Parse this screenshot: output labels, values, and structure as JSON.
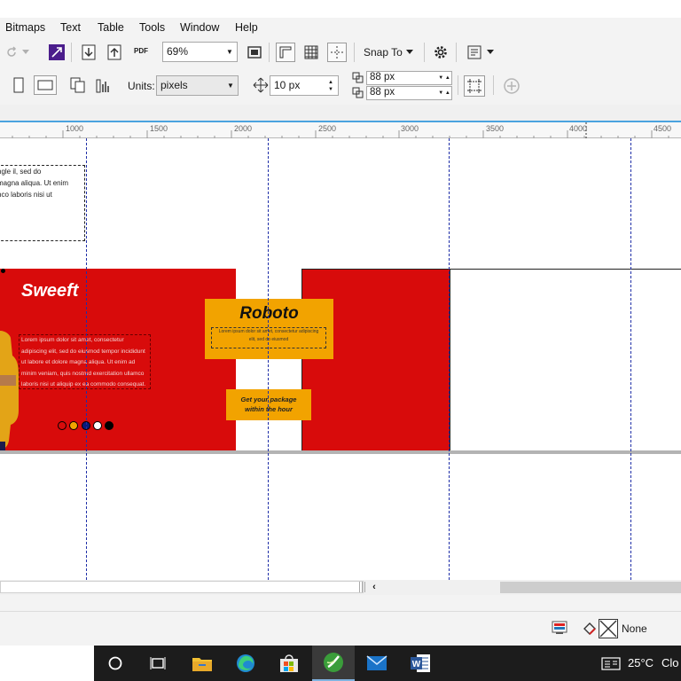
{
  "menu": {
    "items": [
      {
        "label": "Bitmaps"
      },
      {
        "label": "Text"
      },
      {
        "label": "Table"
      },
      {
        "label": "Tools"
      },
      {
        "label": "Window"
      },
      {
        "label": "Help"
      }
    ]
  },
  "toolbar": {
    "zoom_value": "69%",
    "snap_label": "Snap To",
    "pdf_label": "PDF"
  },
  "property_bar": {
    "units_label": "Units:",
    "units_value": "pixels",
    "nudge_value": "10 px",
    "dup_x_value": "88 px",
    "dup_y_value": "88 px"
  },
  "ruler": {
    "labels": [
      "1000",
      "1500",
      "2000",
      "2500",
      "3000",
      "3500",
      "4000",
      "4500"
    ]
  },
  "canvas": {
    "textbox_lines": [
      "ngle il, sed do",
      "magna aliqua. Ut enim",
      "nco laboris nisi ut"
    ],
    "banner": {
      "brand": "Sweeft",
      "body_lines": [
        "Lorem ipsum dolor sit amet, consectetur",
        "adipiscing elit, sed do eiusmod tempor incididunt",
        "ut labore et dolore magna aliqua. Ut enim ad",
        "minim veniam, quis nostrud exercitation ullamco",
        "laboris nisi ut aliquip ex ea commodo consequat."
      ],
      "swatch_colors": [
        "#d80b0b",
        "#f2a300",
        "#0a1a7a",
        "#ffffff",
        "#000000"
      ],
      "heading": "Roboto",
      "sub_lines": [
        "Lorem ipsum dolor sit amet, consectetur adipiscing",
        "elit, sed do eiusmod"
      ],
      "cta_lines": [
        "Get your package",
        "within the hour"
      ],
      "red": "#d80b0b",
      "orange": "#f2a300"
    }
  },
  "status": {
    "fill_label": "None"
  },
  "taskbar": {
    "temperature": "25°C",
    "weather_text": "Clo"
  }
}
